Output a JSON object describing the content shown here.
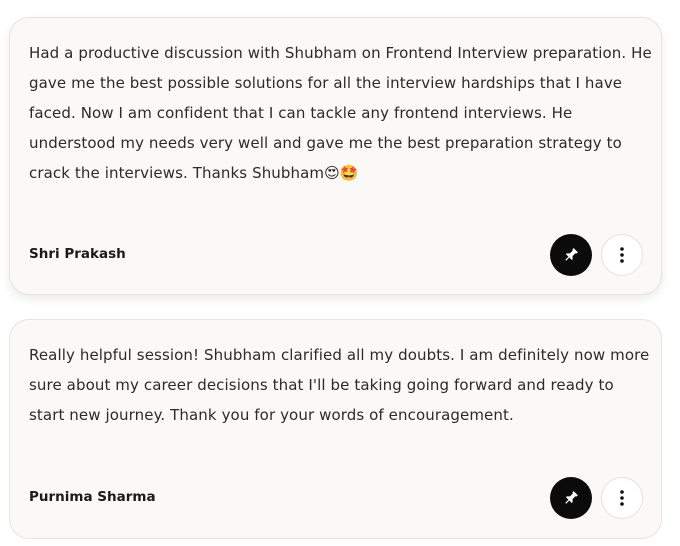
{
  "testimonials": [
    {
      "text": "Had a productive discussion with Shubham on Frontend Interview preparation. He gave me the best possible solutions for all the interview hardships that I have faced. Now I am confident that I can tackle any frontend interviews. He understood my needs very well and gave me the best preparation strategy to crack the interviews. Thanks Shubham😍🤩",
      "author": "Shri Prakash",
      "pin_icon": "pin-icon",
      "more_icon": "more-vertical-icon"
    },
    {
      "text": "Really helpful session! Shubham clarified all my doubts. I am definitely now more sure about my career decisions that I'll be taking going forward and ready to start new journey. Thank you for your words of encouragement.",
      "author": "Purnima Sharma",
      "pin_icon": "pin-icon",
      "more_icon": "more-vertical-icon"
    }
  ],
  "colors": {
    "card_background": "#faf9f7",
    "pin_button": "#0b0b0b",
    "text": "#2b2b2b"
  }
}
